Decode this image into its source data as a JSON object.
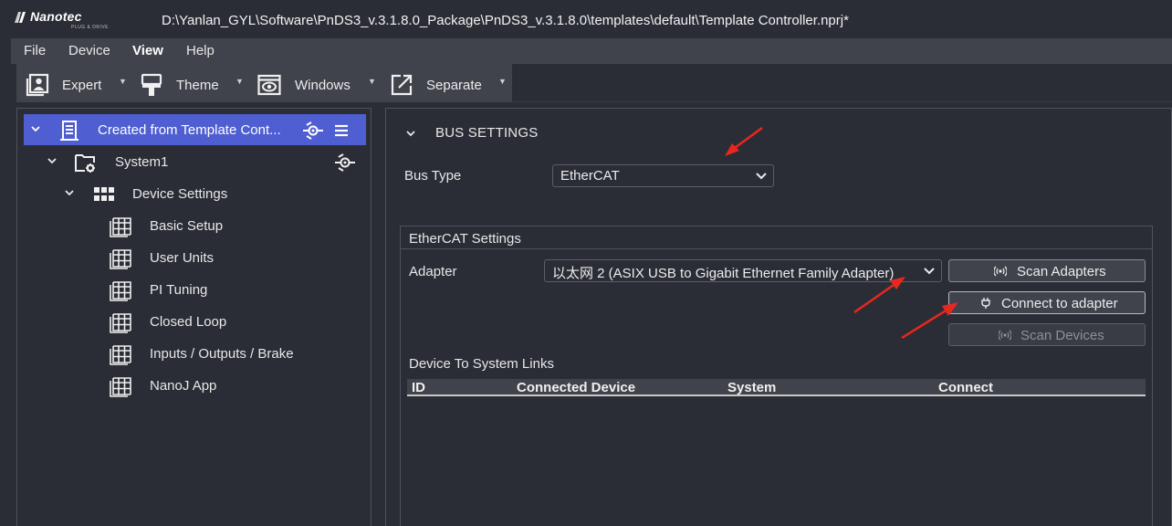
{
  "window": {
    "logo_brand": "Nanotec",
    "logo_tagline": "PLUG & DRIVE",
    "title": "D:\\Yanlan_GYL\\Software\\PnDS3_v.3.1.8.0_Package\\PnDS3_v.3.1.8.0\\templates\\default\\Template Controller.nprj*"
  },
  "menu": {
    "items": [
      {
        "label": "File"
      },
      {
        "label": "Device"
      },
      {
        "label": "View",
        "active": true
      },
      {
        "label": "Help"
      }
    ]
  },
  "toolbar": {
    "buttons": [
      {
        "label": "Expert",
        "icon": "expert-icon"
      },
      {
        "label": "Theme",
        "icon": "theme-icon"
      },
      {
        "label": "Windows",
        "icon": "windows-icon"
      },
      {
        "label": "Separate",
        "icon": "separate-icon"
      }
    ]
  },
  "tree": {
    "root": {
      "label": "Created from Template Cont...",
      "selected": true
    },
    "system": {
      "label": "System1"
    },
    "device_settings": {
      "label": "Device Settings"
    },
    "items": [
      {
        "label": "Basic Setup"
      },
      {
        "label": "User Units"
      },
      {
        "label": "PI Tuning"
      },
      {
        "label": "Closed Loop"
      },
      {
        "label": "Inputs / Outputs / Brake"
      },
      {
        "label": "NanoJ App"
      }
    ]
  },
  "bus_settings": {
    "section_title": "BUS SETTINGS",
    "bus_type_label": "Bus Type",
    "bus_type_value": "EtherCAT"
  },
  "ethercat": {
    "group_title": "EtherCAT Settings",
    "adapter_label": "Adapter",
    "adapter_value": "以太网 2 (ASIX USB to Gigabit Ethernet Family Adapter)",
    "scan_adapters_label": "Scan Adapters",
    "connect_label": "Connect to adapter",
    "scan_devices_label": "Scan Devices",
    "links_label": "Device To System Links",
    "columns": [
      "ID",
      "Connected Device",
      "System",
      "Connect"
    ]
  },
  "colors": {
    "selection": "#4f5ed1",
    "annotation_arrow": "#e8281e",
    "background": "#2b2d36"
  }
}
